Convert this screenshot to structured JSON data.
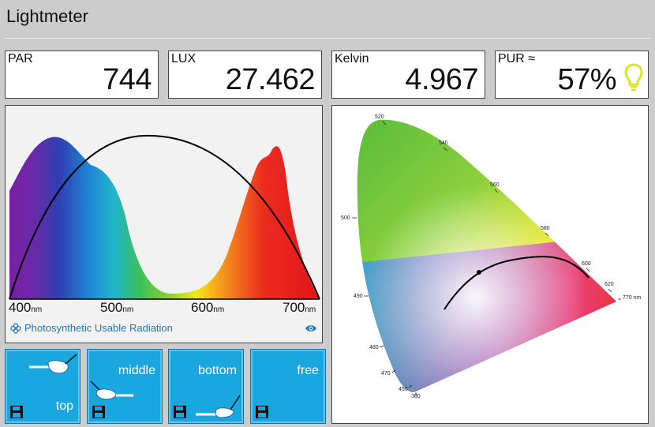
{
  "app": {
    "title": "Lightmeter"
  },
  "metrics": [
    {
      "label": "PAR",
      "value": "744"
    },
    {
      "label": "LUX",
      "value": "27.462"
    },
    {
      "label": "Kelvin",
      "value": "4.967"
    },
    {
      "label": "PUR ≈",
      "value": "57%"
    }
  ],
  "spectrum": {
    "axis_ticks": [
      {
        "num": "400",
        "unit": "nm"
      },
      {
        "num": "500",
        "unit": "nm"
      },
      {
        "num": "600",
        "unit": "nm"
      },
      {
        "num": "700",
        "unit": "nm"
      }
    ],
    "pur_text": "Photosynthetic Usable Radiation"
  },
  "presets": [
    {
      "label": "top"
    },
    {
      "label": "middle"
    },
    {
      "label": "bottom"
    },
    {
      "label": "free"
    }
  ],
  "cie": {
    "wavelength_labels": [
      "520",
      "540",
      "560",
      "580",
      "600",
      "620",
      "770 nm",
      "500",
      "490",
      "480",
      "470",
      "450",
      "380"
    ]
  },
  "colors": {
    "accent_blue": "#1aa6de",
    "bulb_yellow": "#d8e81c",
    "link_blue": "#1e74b8"
  },
  "icons": [
    "bulb-icon",
    "flower-icon",
    "eye-icon",
    "save-icon",
    "hand-icon"
  ]
}
